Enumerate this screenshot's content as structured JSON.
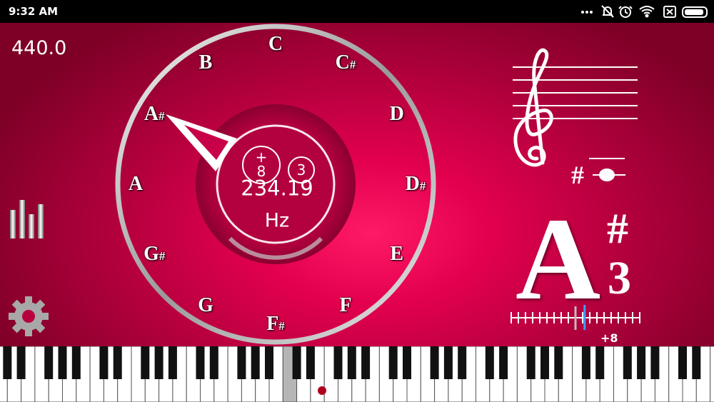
{
  "status_bar": {
    "time": "9:32 AM",
    "icons": [
      "more-icon",
      "alarm-off-icon",
      "alarm-icon",
      "wifi-icon",
      "sim-icon",
      "battery-icon"
    ]
  },
  "tuner": {
    "reference_frequency": "440.0",
    "frequency": "234.19",
    "unit": "Hz",
    "cents_sign": "+",
    "cents_value": "8",
    "octave": "3",
    "detected_note": "A",
    "detected_accidental": "#",
    "detected_octave": "3",
    "staff_accidental": "#",
    "cents_readout": "+8",
    "needle_note": "A#"
  },
  "dial_notes": [
    {
      "name": "C",
      "sharp": ""
    },
    {
      "name": "C",
      "sharp": "#"
    },
    {
      "name": "D",
      "sharp": ""
    },
    {
      "name": "D",
      "sharp": "#"
    },
    {
      "name": "E",
      "sharp": ""
    },
    {
      "name": "F",
      "sharp": ""
    },
    {
      "name": "F",
      "sharp": "#"
    },
    {
      "name": "G",
      "sharp": ""
    },
    {
      "name": "G",
      "sharp": "#"
    },
    {
      "name": "A",
      "sharp": ""
    },
    {
      "name": "A",
      "sharp": "#"
    },
    {
      "name": "B",
      "sharp": ""
    }
  ],
  "sidebar": {
    "mode_icon": "equalizer-icon",
    "settings_icon": "gear-icon"
  },
  "colors": {
    "background_center": "#ff1a66",
    "background_edge": "#7e0027",
    "cents_marker": "#3aa0ff",
    "piano_marker": "#b00020"
  }
}
